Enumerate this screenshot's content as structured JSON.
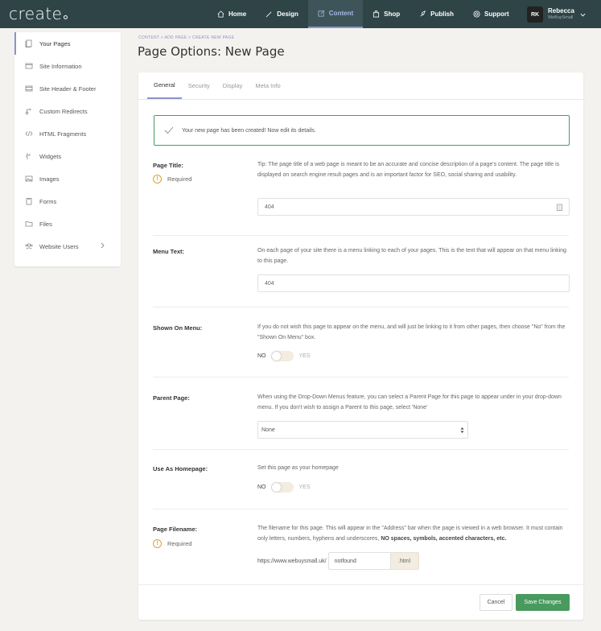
{
  "app": {
    "logo": "create"
  },
  "nav": [
    {
      "label": "Home",
      "icon": "home-icon"
    },
    {
      "label": "Design",
      "icon": "brush-icon"
    },
    {
      "label": "Content",
      "icon": "edit-icon",
      "active": true
    },
    {
      "label": "Shop",
      "icon": "bag-icon"
    },
    {
      "label": "Publish",
      "icon": "rocket-icon"
    },
    {
      "label": "Support",
      "icon": "lifebuoy-icon"
    }
  ],
  "user": {
    "initials": "RK",
    "name": "Rebecca",
    "handle": "WeBuySmall"
  },
  "sidebar": {
    "items": [
      {
        "label": "Your Pages",
        "icon": "pages-icon"
      },
      {
        "label": "Site Information",
        "icon": "window-icon"
      },
      {
        "label": "Site Header & Footer",
        "icon": "layout-icon"
      },
      {
        "label": "Custom Redirects",
        "icon": "redirect-icon"
      },
      {
        "label": "HTML Fragments",
        "icon": "code-icon"
      },
      {
        "label": "Widgets",
        "icon": "puzzle-icon"
      },
      {
        "label": "Images",
        "icon": "image-icon"
      },
      {
        "label": "Forms",
        "icon": "form-icon"
      },
      {
        "label": "Files",
        "icon": "folder-icon"
      },
      {
        "label": "Website Users",
        "icon": "users-icon"
      }
    ]
  },
  "breadcrumb": "CONTENT > ADD PAGE > CREATE NEW PAGE",
  "page_title": "Page Options: New Page",
  "tabs": [
    "General",
    "Security",
    "Display",
    "Meta Info"
  ],
  "success_message": "Your new page has been created! Now edit its details.",
  "required_label": "Required",
  "fields": {
    "page_title": {
      "label": "Page Title:",
      "help": "Tip: The page title of a web page is meant to be an accurate and concise description of a page's content. The page title is displayed on search engine result pages and is an important factor for SEO, social sharing and usability.",
      "value": "404"
    },
    "menu_text": {
      "label": "Menu Text:",
      "help": "On each page of your site there is a menu linking to each of your pages. This is the text that will appear on that menu linking to this page.",
      "value": "404"
    },
    "shown_on_menu": {
      "label": "Shown On Menu:",
      "help": "If you do not wish this page to appear on the menu, and will just be linking to it from other pages, then choose \"No\" from the \"Shown On Menu\" box.",
      "off_label": "NO",
      "on_label": "YES"
    },
    "parent_page": {
      "label": "Parent Page:",
      "help": "When using the Drop-Down Menus feature, you can select a Parent Page for this page to appear under in your drop-down menu. If you don't wish to assign a Parent to this page, select 'None'",
      "value": "None"
    },
    "use_as_homepage": {
      "label": "Use As Homepage:",
      "help": "Set this page as your homepage",
      "off_label": "NO",
      "on_label": "YES"
    },
    "page_filename": {
      "label": "Page Filename:",
      "help_plain": "The filename for this page. This will appear in the \"Address\" bar when the page is viewed in a web browser. It must contain only letters, numbers, hyphens and underscores,",
      "help_bold": "NO spaces, symbols, accented characters, etc.",
      "prefix": "https://www.webuysmall.uk/",
      "value": "notfound",
      "suffix": ".html"
    }
  },
  "buttons": {
    "cancel": "Cancel",
    "save": "Save Changes"
  },
  "colors": {
    "topbar": "#2e4447",
    "accent": "#8a94c9",
    "success": "#4a9a5f",
    "warning": "#e0a030"
  }
}
